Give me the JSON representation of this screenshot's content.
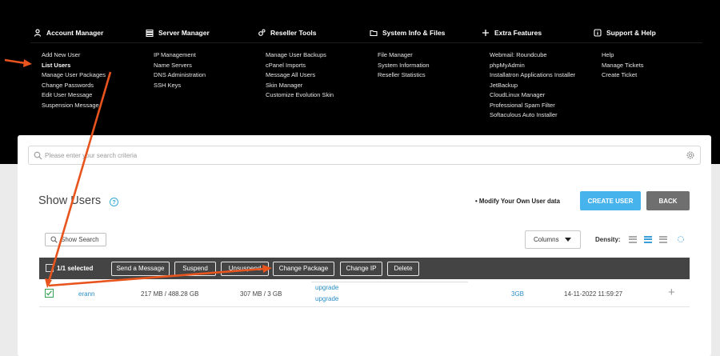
{
  "nav": {
    "columns": [
      {
        "title": "Account Manager",
        "icon": "user-icon",
        "items": [
          "Add New User",
          "List Users",
          "Manage User Packages",
          "Change Passwords",
          "Edit User Message",
          "Suspension Message"
        ]
      },
      {
        "title": "Server Manager",
        "icon": "server-icon",
        "items": [
          "IP Management",
          "Name Servers",
          "DNS Administration",
          "SSH Keys"
        ]
      },
      {
        "title": "Reseller Tools",
        "icon": "gears-icon",
        "items": [
          "Manage User Backups",
          "cPanel Imports",
          "Message All Users",
          "Skin Manager",
          "Customize Evolution Skin"
        ]
      },
      {
        "title": "System Info & Files",
        "icon": "folder-icon",
        "items": [
          "File Manager",
          "System Information",
          "Reseller Statistics"
        ]
      },
      {
        "title": "Extra Features",
        "icon": "plus-icon",
        "items": [
          "Webmail: Roundcube",
          "phpMyAdmin",
          "Installatron Applications Installer",
          "JetBackup",
          " CloudLinux Manager",
          "Professional Spam Filter",
          "Softaculous Auto Installer"
        ]
      },
      {
        "title": "Support & Help",
        "icon": "info-icon",
        "items": [
          "Help",
          "Manage Tickets",
          "Create Ticket"
        ]
      }
    ]
  },
  "search": {
    "placeholder": "Please enter your search criteria"
  },
  "page": {
    "title": "Show Users",
    "modify_link": "• Modify Your Own User data",
    "create_button": "CREATE USER",
    "back_button": "BACK"
  },
  "toolbar": {
    "show_search": "Show Search",
    "columns": "Columns",
    "density_label": "Density:"
  },
  "selection": {
    "count": "1/1 selected",
    "actions": [
      "Send a Message",
      "Suspend",
      "Unsuspend",
      "Change Package",
      "Change IP",
      "Delete"
    ]
  },
  "rows": [
    {
      "username": "erann",
      "bandwidth": "217 MB / 488.28 GB",
      "disk": "307 MB / 3 GB",
      "upgrade_1": "upgrade",
      "upgrade_2": "upgrade",
      "package": "3GB",
      "created": "14-11-2022 11:59:27"
    }
  ],
  "colors": {
    "nav_bg": "#000000",
    "accent": "#46b3ec",
    "annotation": "#e8541e",
    "selbar": "#444444"
  }
}
